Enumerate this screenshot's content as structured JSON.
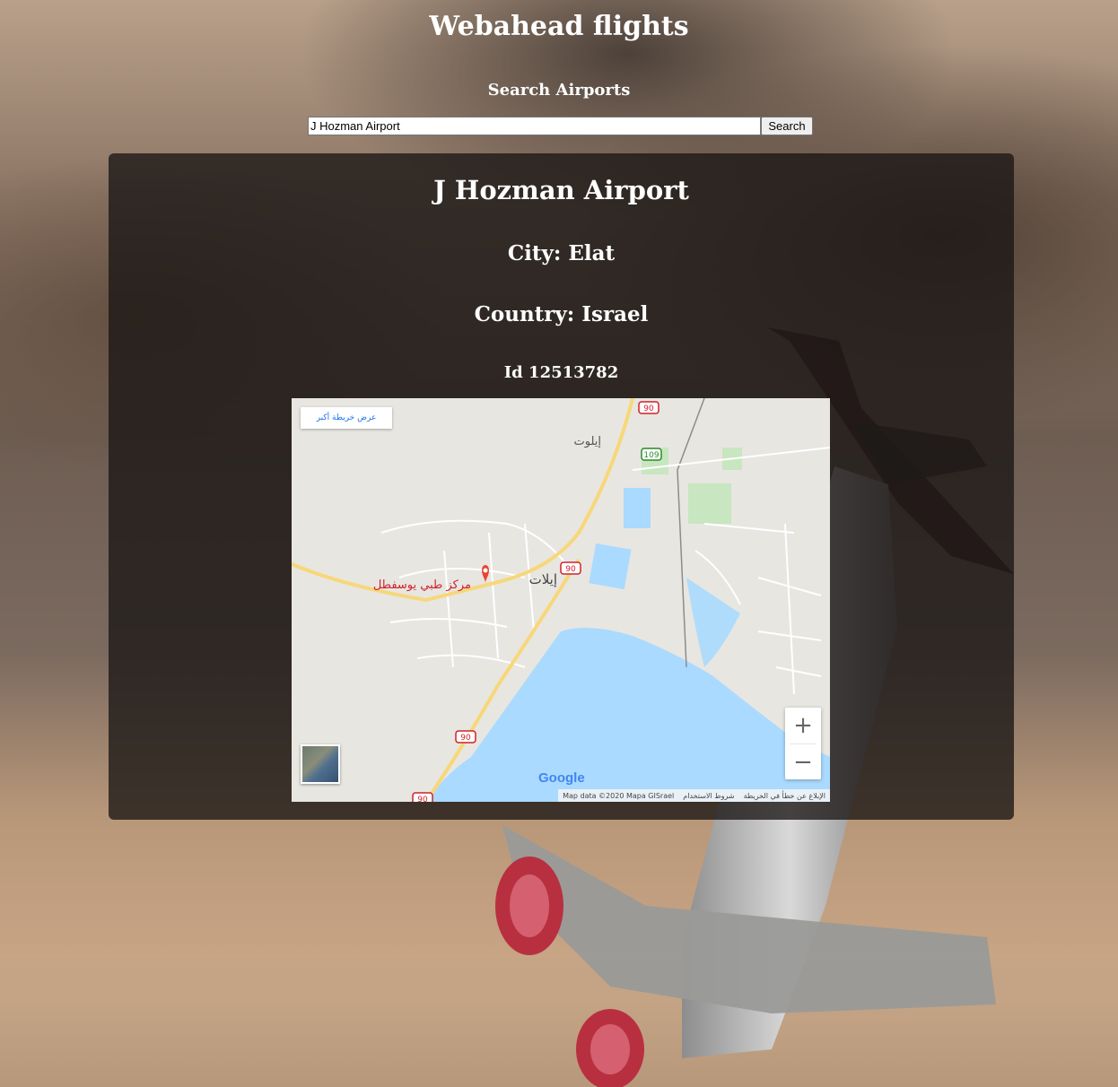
{
  "app": {
    "title": "Webahead flights"
  },
  "search": {
    "heading": "Search Airports",
    "value": "J Hozman Airport",
    "button_label": "Search"
  },
  "airport": {
    "name": "J Hozman Airport",
    "city_line": "City: Elat",
    "country_line": "Country: Israel",
    "id_line": "Id 12513782"
  },
  "map": {
    "larger_map_link": "عرض خريطة أكبر",
    "place_marker_label": "مركز طبي يوسفطل",
    "city_label": "إيلات",
    "north_label": "إيلوت",
    "road_labels": [
      "90",
      "109",
      "90",
      "90",
      "90"
    ],
    "zoom_in": "+",
    "zoom_out": "−",
    "google_logo": "Google",
    "attribution": {
      "report": "الإبلاغ عن خطأ في الخريطة",
      "terms": "شروط الاستخدام",
      "data": "Map data ©2020 Mapa GISrael"
    },
    "colors": {
      "water": "#aadaff",
      "land": "#e8e6e1",
      "road": "#f7d779",
      "park": "#c8e6c0",
      "marker": "#ea4335"
    }
  },
  "icons": {
    "zoom_in": "plus-icon",
    "zoom_out": "minus-icon",
    "marker": "map-pin-icon",
    "satellite": "satellite-thumbnail-icon"
  }
}
